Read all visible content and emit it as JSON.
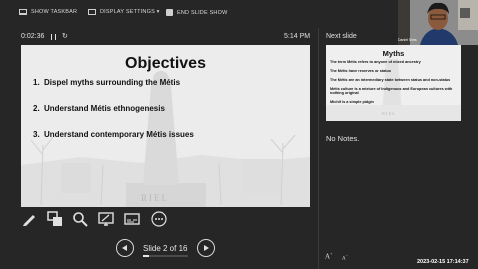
{
  "toolbar": {
    "show_taskbar": "SHOW TASKBAR",
    "display_settings": "DISPLAY SETTINGS ▾",
    "end_slide_show": "END SLIDE SHOW"
  },
  "timer": {
    "elapsed": "0:02:36",
    "clock": "5:14 PM"
  },
  "current_slide": {
    "title": "Objectives",
    "items": [
      {
        "num": "1.",
        "text": "Dispel myths surrounding the Métis"
      },
      {
        "num": "2.",
        "text": "Understand Métis ethnogenesis"
      },
      {
        "num": "3.",
        "text": "Understand contemporary Métis issues"
      }
    ],
    "background_text": "RIEL"
  },
  "next_slide": {
    "label": "Next slide",
    "title": "Myths",
    "items": [
      "The term Métis refers to anyone of mixed ancestry",
      "The Métis have reserves or status",
      "The Métis are an intermediary state between status and non-status",
      "Métis culture is a mixture of Indigenous and European cultures with nothing original",
      "Michif is a simple pidgin"
    ],
    "background_text": "RIEL"
  },
  "notes": "No Notes.",
  "webcam": {
    "name": "Daniel Sims"
  },
  "navigation": {
    "counter": "Slide 2 of 16",
    "progress": 0.125
  },
  "zoom": {
    "increase": "A",
    "decrease": "A"
  },
  "video_timestamp": "2023-02-15  17:14:37",
  "icons": [
    "taskbar-icon",
    "display-icon",
    "end-icon",
    "pause-icon",
    "restart-icon",
    "pen-icon",
    "slides-grid-icon",
    "zoom-icon",
    "screen-icon",
    "more-icon",
    "prev-icon",
    "next-icon"
  ]
}
